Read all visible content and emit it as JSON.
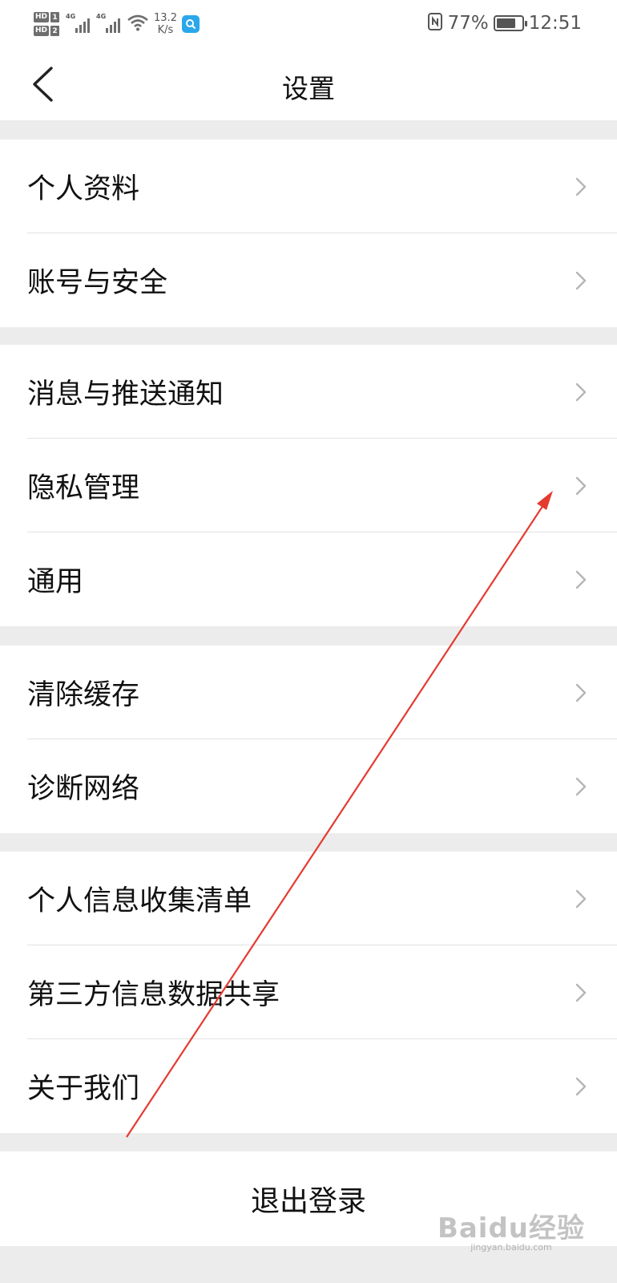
{
  "status_bar": {
    "sim1_label": "HD",
    "sim1_num": "1",
    "sim2_label": "HD",
    "sim2_num": "2",
    "network1": "4G",
    "network2": "4G",
    "speed_value": "13.2",
    "speed_unit": "K/s",
    "battery_percent": "77%",
    "battery_level": 0.77,
    "time": "12:51"
  },
  "header": {
    "title": "设置"
  },
  "sections": [
    {
      "items": [
        {
          "label": "个人资料"
        },
        {
          "label": "账号与安全"
        }
      ]
    },
    {
      "items": [
        {
          "label": "消息与推送通知"
        },
        {
          "label": "隐私管理"
        },
        {
          "label": "通用"
        }
      ]
    },
    {
      "items": [
        {
          "label": "清除缓存"
        },
        {
          "label": "诊断网络"
        }
      ]
    },
    {
      "items": [
        {
          "label": "个人信息收集清单"
        },
        {
          "label": "第三方信息数据共享"
        },
        {
          "label": "关于我们"
        }
      ]
    }
  ],
  "logout_label": "退出登录",
  "watermark": {
    "logo": "Baidu经验",
    "url": "jingyan.baidu.com"
  },
  "colors": {
    "background": "#ececec",
    "surface": "#ffffff",
    "annotation_arrow": "#e53a30"
  }
}
